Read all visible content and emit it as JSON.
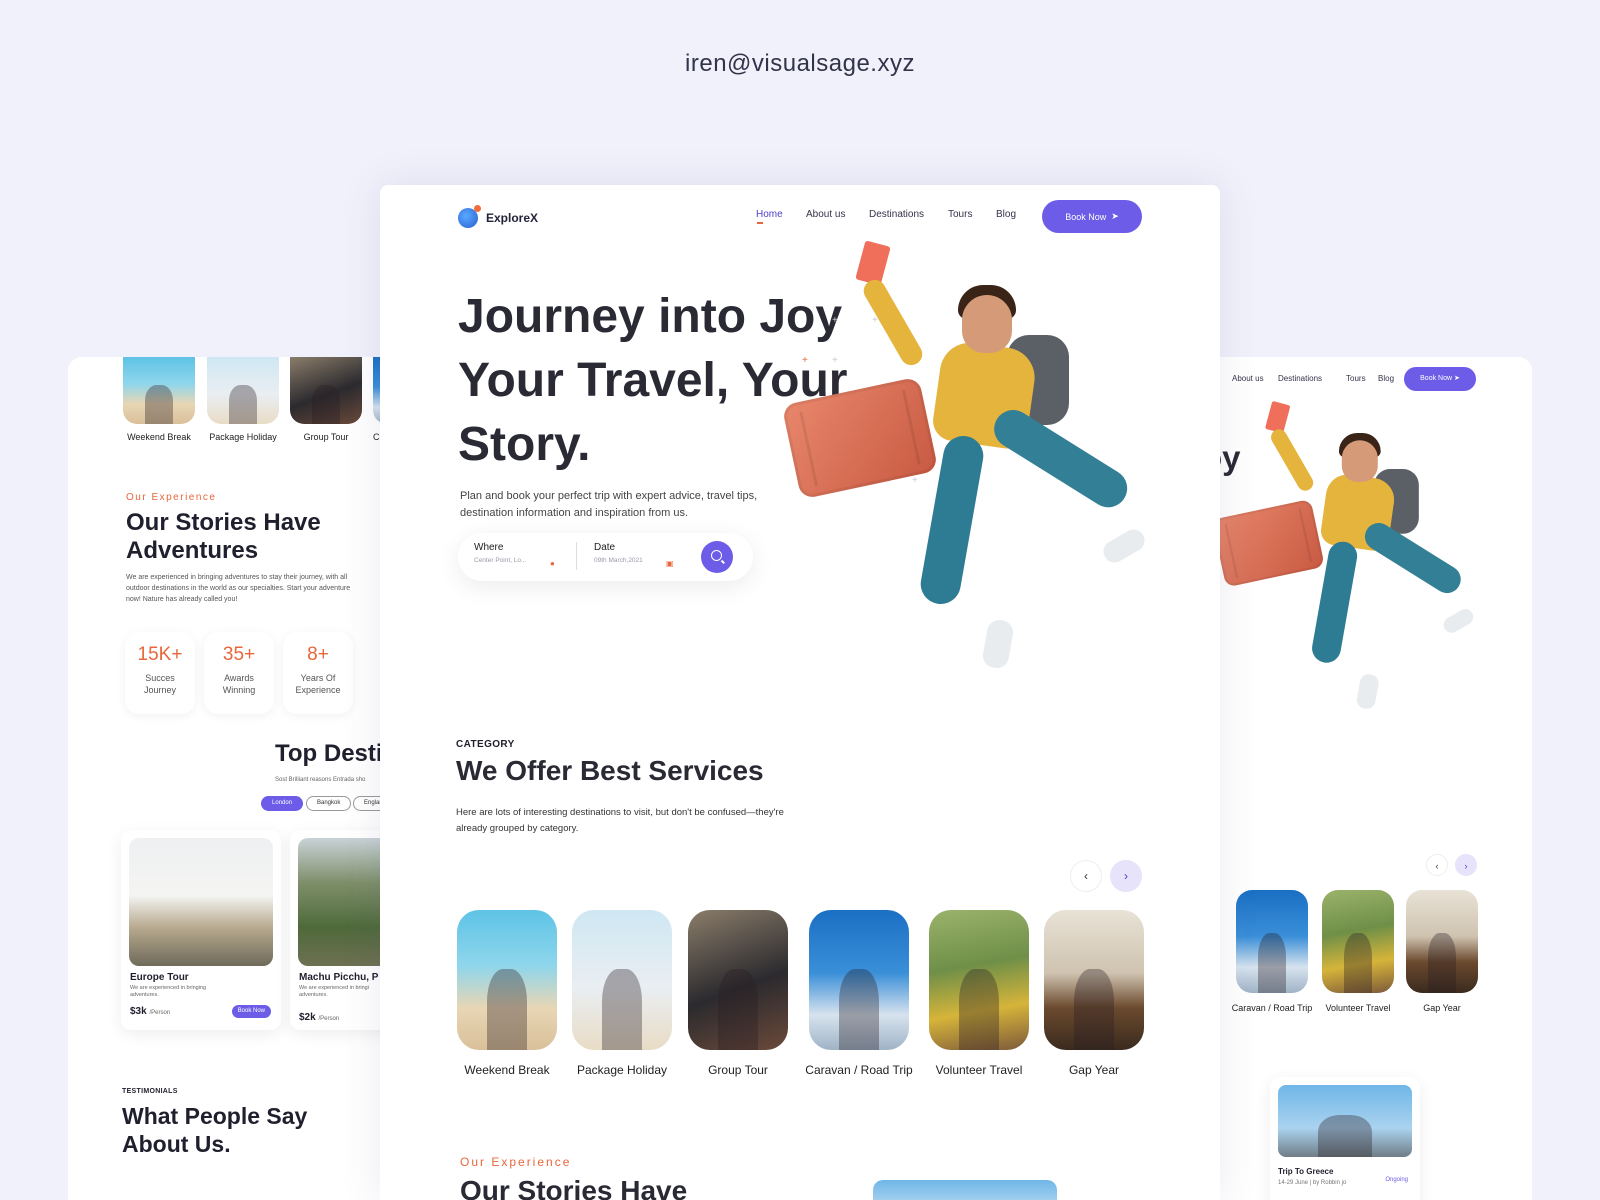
{
  "header": {
    "email": "iren@visualsage.xyz"
  },
  "main": {
    "brand": "ExploreX",
    "nav": [
      "Home",
      "About us",
      "Destinations",
      "Tours",
      "Blog"
    ],
    "book_now": "Book Now",
    "hero_title": "Journey into Joy Your Travel, Your Story.",
    "hero_text": "Plan and book your perfect trip with expert advice, travel tips, destination information and inspiration from us.",
    "search": {
      "where_label": "Where",
      "where_value": "Center Point, Lo...",
      "date_label": "Date",
      "date_value": "09th March,2021"
    },
    "category": {
      "eyebrow": "CATEGORY",
      "title": "We Offer Best Services",
      "text": "Here are lots of interesting destinations to visit, but don't be confused—they're already grouped by category.",
      "items": [
        "Weekend Break",
        "Package Holiday",
        "Group Tour",
        "Caravan / Road Trip",
        "Volunteer Travel",
        "Gap Year"
      ]
    },
    "experience": {
      "eyebrow": "Our Experience",
      "title": "Our Stories Have"
    }
  },
  "left": {
    "categories": [
      "Weekend Break",
      "Package Holiday",
      "Group Tour",
      "C"
    ],
    "experience_eyebrow": "Our Experience",
    "experience_title": "Our Stories Have Adventures",
    "experience_text": "We are experienced in bringing adventures to stay their journey, with all outdoor destinations in the world as our specialties. Start your adventure now! Nature has already called you!",
    "stats": [
      {
        "value": "15K+",
        "label": "Succes Journey"
      },
      {
        "value": "35+",
        "label": "Awards Winning"
      },
      {
        "value": "8+",
        "label": "Years Of Experience"
      }
    ],
    "top_destinations_title": "Top Desti",
    "top_destinations_sub": "Sost Brilliant reasons Entrada sho",
    "tabs": [
      "London",
      "Bangkok",
      "Englan"
    ],
    "tours": [
      {
        "name": "Europe Tour",
        "desc": "We are experienced in bringing adventures.",
        "price": "$3k",
        "per": "/Person",
        "button": "Book Now"
      },
      {
        "name": "Machu Picchu, P",
        "desc": "We are experienced in bringi adventures.",
        "price": "$2k",
        "per": "/Person"
      }
    ],
    "testimonials_eyebrow": "TESTIMONIALS",
    "testimonials_title": "What People Say About Us."
  },
  "right": {
    "nav": [
      "About us",
      "Destinations",
      "Tours",
      "Blog"
    ],
    "book_now": "Book Now",
    "hero_fragment": "oy",
    "categories": [
      "Caravan / Road Trip",
      "Volunteer Travel",
      "Gap Year"
    ],
    "trip": {
      "title": "Trip To Greece",
      "meta": "14-29 June | by Robbin jo",
      "status": "Ongoing"
    }
  }
}
